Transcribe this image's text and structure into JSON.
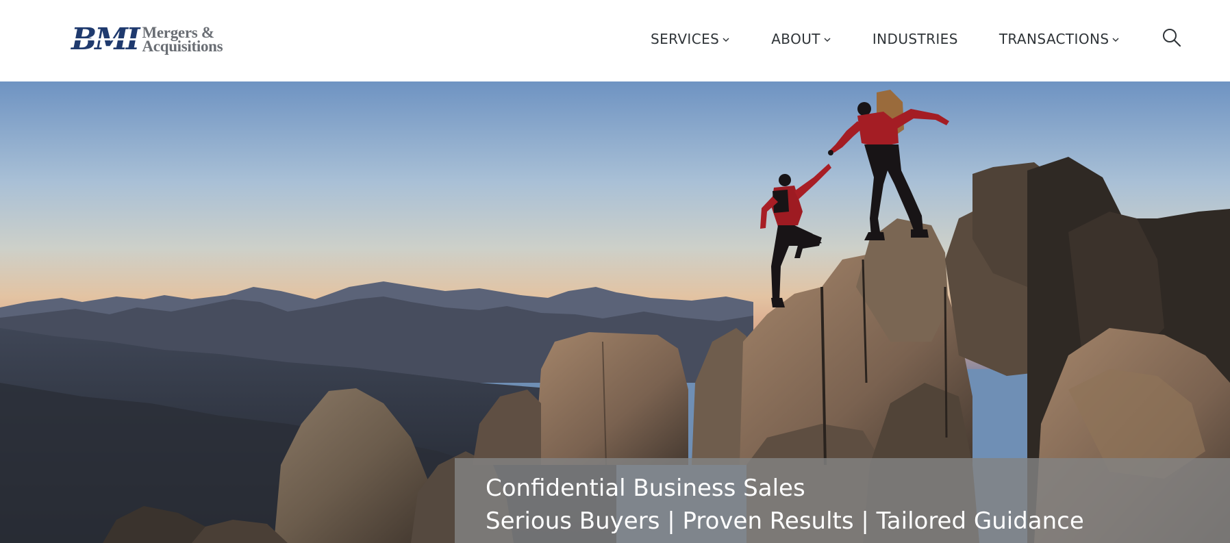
{
  "brand": {
    "mark": "BMI",
    "line1": "Mergers &",
    "line2": "Acquisitions"
  },
  "nav": {
    "items": [
      {
        "label": "SERVICES",
        "has_dropdown": true
      },
      {
        "label": "ABOUT",
        "has_dropdown": true
      },
      {
        "label": "INDUSTRIES",
        "has_dropdown": false
      },
      {
        "label": "TRANSACTIONS",
        "has_dropdown": true
      }
    ],
    "search_icon": "search-icon"
  },
  "hero": {
    "image": "climber-helping-partner-on-mountain-summit-at-sunset",
    "caption_line1": "Confidential Business Sales",
    "caption_line2": "Serious Buyers | Proven Results | Tailored Guidance"
  },
  "colors": {
    "brand_blue": "#1f3a6e",
    "brand_gray": "#6a6e74",
    "nav_text": "#2f3438",
    "caption_bg": "#828282"
  }
}
